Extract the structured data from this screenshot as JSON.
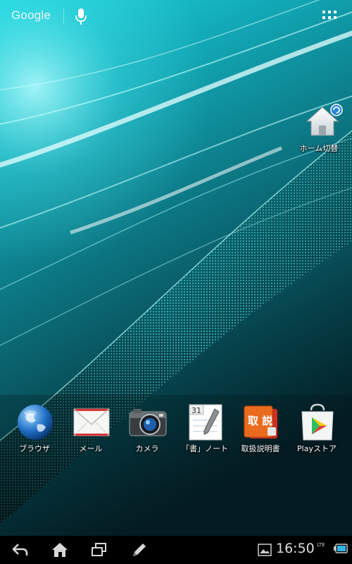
{
  "topbar": {
    "google_label": "Google",
    "icons": [
      "mic-icon",
      "all-apps-grid-icon"
    ]
  },
  "home_shortcut": {
    "label": "ホーム切替",
    "icon": "home-switch-icon"
  },
  "dock": {
    "items": [
      {
        "label": "ブラウザ",
        "icon": "globe-icon"
      },
      {
        "label": "メール",
        "icon": "envelope-icon"
      },
      {
        "label": "カメラ",
        "icon": "camera-icon"
      },
      {
        "label": "「書」ノート",
        "icon": "notepad-icon",
        "calendar_day": "31"
      },
      {
        "label": "取扱説明書",
        "icon": "manual-book-icon",
        "book_text": "取 説"
      },
      {
        "label": "Playストア",
        "icon": "play-store-icon"
      }
    ]
  },
  "navbar": {
    "buttons": [
      "back-icon",
      "home-icon",
      "recent-apps-icon",
      "pen-icon"
    ]
  },
  "status": {
    "time": "16:50",
    "network": "LTE",
    "icons": [
      "gallery-icon",
      "battery-icon"
    ]
  },
  "colors": {
    "wallpaper_dark": "#042a30",
    "wallpaper_teal": "#14b6c4",
    "wallpaper_light": "#7ff4f6",
    "navbar": "#000000"
  }
}
